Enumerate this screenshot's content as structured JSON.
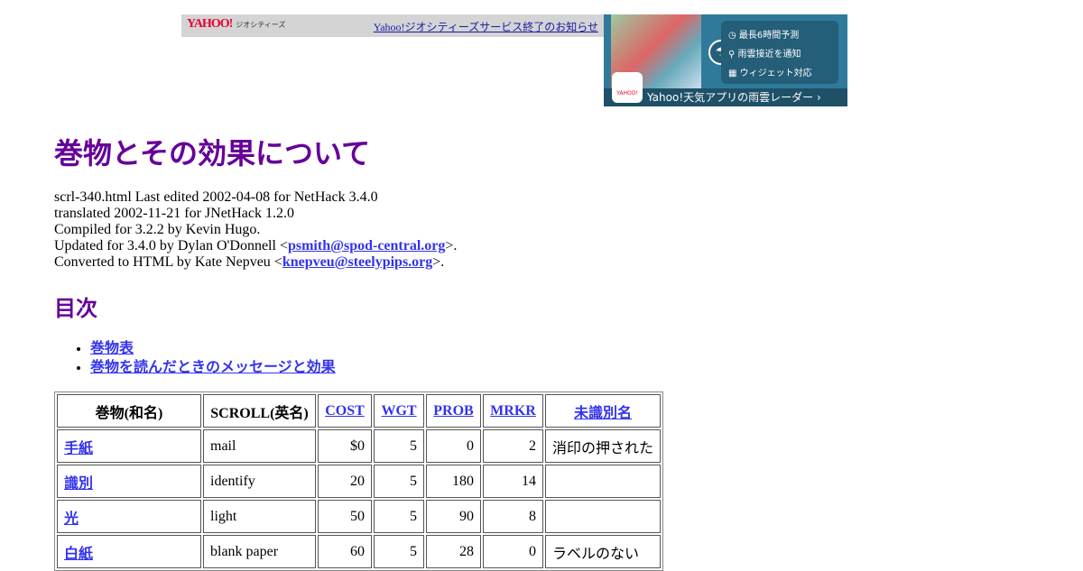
{
  "geocities_bar": {
    "logo": "YAHOO!",
    "logo_sub": "ジオシティーズ",
    "notice_link": "Yahoo!ジオシティーズサービス終了のお知らせ"
  },
  "ad": {
    "features": [
      "最長6時間予測",
      "雨雲接近を通知",
      "ウィジェット対応"
    ],
    "banner": "Yahoo!天気アプリの雨雲レーダー ›",
    "app_label": "YAHOO!"
  },
  "title": "巻物とその効果について",
  "meta": {
    "line1": "scrl-340.html Last edited 2002-04-08 for NetHack 3.4.0",
    "line2": "translated 2002-11-21 for JNetHack 1.2.0",
    "line3": "Compiled for 3.2.2 by Kevin Hugo.",
    "line4_pre": "Updated for 3.4.0 by Dylan O'Donnell <",
    "line4_link": "psmith@spod-central.org",
    "line4_post": ">.",
    "line5_pre": "Converted to HTML by Kate Nepveu <",
    "line5_link": "knepveu@steelypips.org",
    "line5_post": ">."
  },
  "toc": {
    "heading": "目次",
    "items": [
      "巻物表",
      "巻物を読んだときのメッセージと効果"
    ]
  },
  "table": {
    "headers": [
      "巻物(和名)",
      "SCROLL(英名)",
      "COST",
      "WGT",
      "PROB",
      "MRKR",
      "未識別名"
    ],
    "rows": [
      [
        "手紙",
        "mail",
        "$0",
        "5",
        "0",
        "2",
        "消印の押された"
      ],
      [
        "識別",
        "identify",
        "20",
        "5",
        "180",
        "14",
        ""
      ],
      [
        "光",
        "light",
        "50",
        "5",
        "90",
        "8",
        ""
      ],
      [
        "白紙",
        "blank paper",
        "60",
        "5",
        "28",
        "0",
        "ラベルのない"
      ]
    ]
  }
}
